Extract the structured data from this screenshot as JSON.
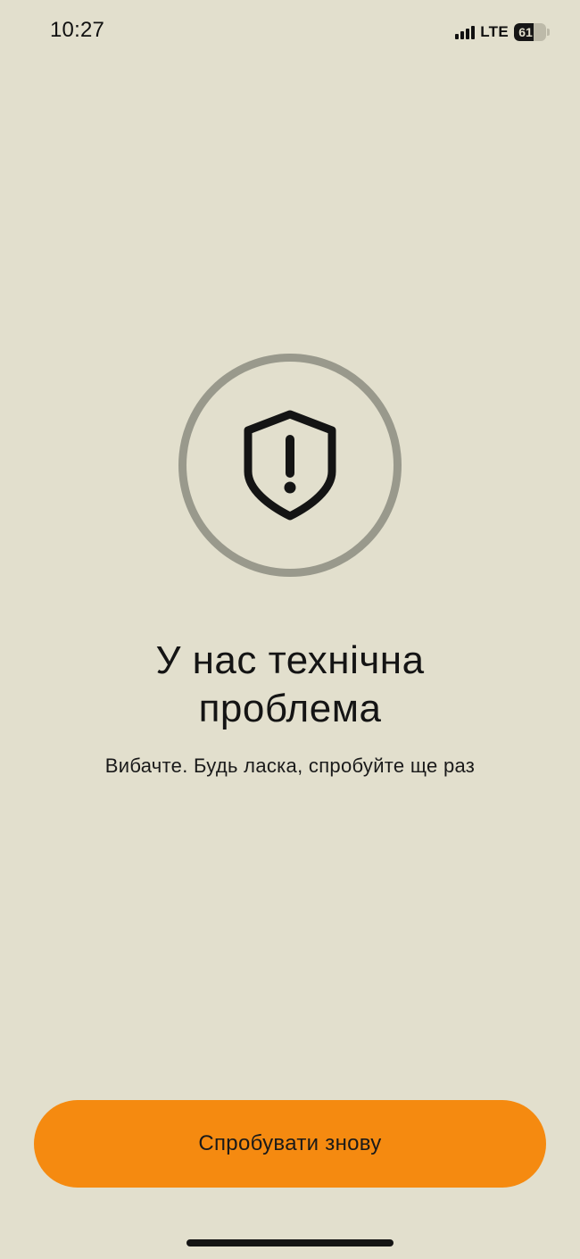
{
  "status_bar": {
    "time": "10:27",
    "network": "LTE",
    "battery_level": "61",
    "signal_bars": 4,
    "icons": [
      "signal-icon",
      "battery-icon"
    ]
  },
  "error": {
    "icon": "shield-exclamation-icon",
    "title_line1": "У нас технічна",
    "title_line2": "проблема",
    "subtitle": "Вибачте. Будь ласка, спробуйте ще раз"
  },
  "actions": {
    "retry_label": "Спробувати знову"
  },
  "colors": {
    "background": "#e2dfcd",
    "ring": "#99998c",
    "button": "#f58a10",
    "text": "#141414"
  }
}
